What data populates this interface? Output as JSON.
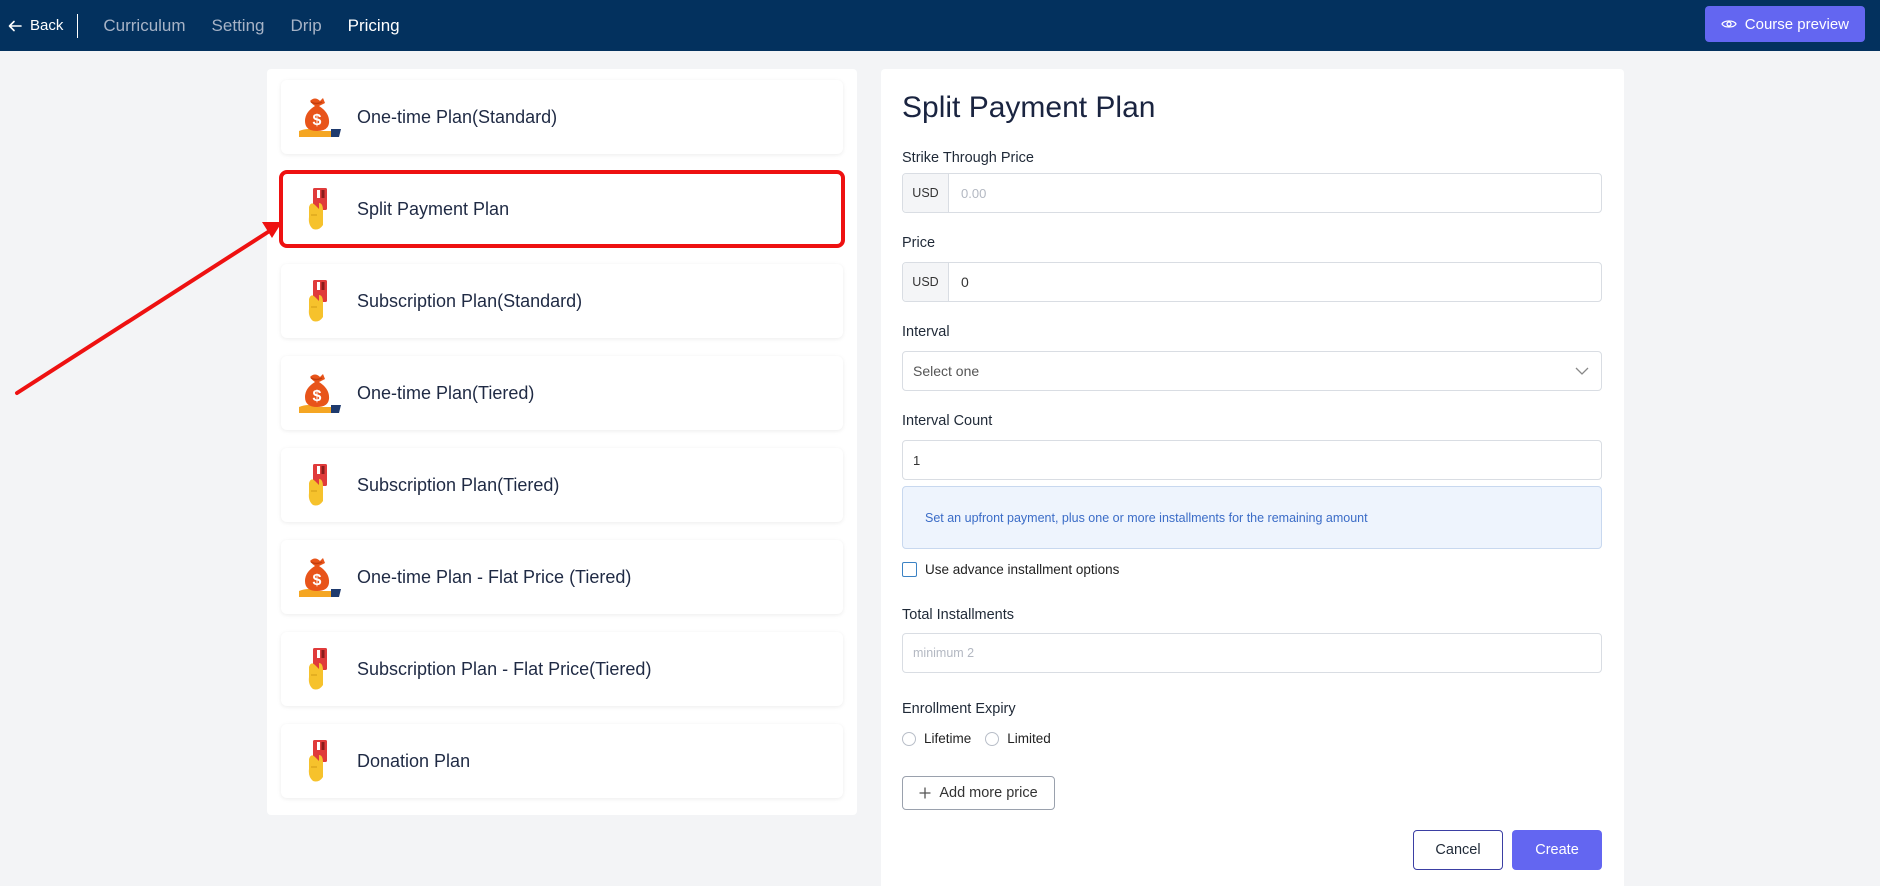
{
  "topbar": {
    "back_label": "Back",
    "tabs": [
      {
        "label": "Curriculum"
      },
      {
        "label": "Setting"
      },
      {
        "label": "Drip"
      },
      {
        "label": "Pricing"
      }
    ],
    "active_tab": "Pricing",
    "preview_label": "Course preview"
  },
  "plans": [
    {
      "name": "One-time Plan(Standard)",
      "icon": "money-bag-icon"
    },
    {
      "name": "Split Payment Plan",
      "icon": "card-hand-icon",
      "selected": true
    },
    {
      "name": "Subscription Plan(Standard)",
      "icon": "card-hand-icon"
    },
    {
      "name": "One-time Plan(Tiered)",
      "icon": "money-bag-icon"
    },
    {
      "name": "Subscription Plan(Tiered)",
      "icon": "card-hand-icon"
    },
    {
      "name": "One-time Plan - Flat Price (Tiered)",
      "icon": "money-bag-icon"
    },
    {
      "name": "Subscription Plan - Flat Price(Tiered)",
      "icon": "card-hand-icon"
    },
    {
      "name": "Donation Plan",
      "icon": "card-hand-icon"
    }
  ],
  "form": {
    "title": "Split Payment Plan",
    "strike_label": "Strike Through Price",
    "strike_currency": "USD",
    "strike_placeholder": "0.00",
    "price_label": "Price",
    "price_currency": "USD",
    "price_value": "0",
    "interval_label": "Interval",
    "interval_placeholder": "Select one",
    "interval_count_label": "Interval Count",
    "interval_count_value": "1",
    "info_text": "Set an upfront payment, plus one or more installments for the remaining amount",
    "advance_label": "Use advance installment options",
    "total_label": "Total Installments",
    "total_placeholder": "minimum 2",
    "expiry_label": "Enrollment Expiry",
    "expiry_options": [
      "Lifetime",
      "Limited"
    ],
    "add_more_label": "Add more price",
    "cancel_label": "Cancel",
    "create_label": "Create"
  },
  "colors": {
    "topbar": "#03315e",
    "accent": "#6366f1",
    "highlight": "#ee1111"
  }
}
